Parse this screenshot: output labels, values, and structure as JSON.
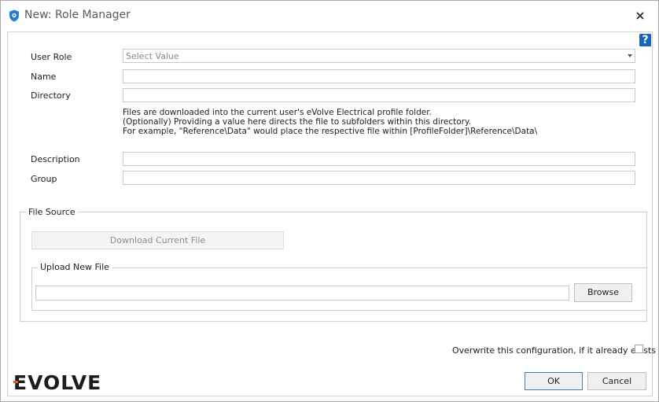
{
  "window": {
    "title": "New: Role Manager",
    "icon": "shield-icon",
    "close_glyph": "✕"
  },
  "help": {
    "label": "?"
  },
  "form": {
    "user_role": {
      "label": "User Role",
      "placeholder": "Select Value"
    },
    "name": {
      "label": "Name",
      "value": ""
    },
    "directory": {
      "label": "Directory",
      "value": "",
      "help_lines": [
        "Files are downloaded into the current user's eVolve Electrical profile folder.",
        "(Optionally) Providing a value here directs the file to subfolders within this directory.",
        "For example, \"Reference\\Data\" would place the respective file within [ProfileFolder]\\Reference\\Data\\"
      ]
    },
    "description": {
      "label": "Description",
      "value": ""
    },
    "group": {
      "label": "Group",
      "value": ""
    }
  },
  "file_source": {
    "title": "File Source",
    "download_button": "Download Current File",
    "upload": {
      "title": "Upload New File",
      "path_value": "",
      "browse_button": "Browse"
    }
  },
  "overwrite": {
    "label": "Overwrite this configuration, if it already exists",
    "checked": false
  },
  "footer": {
    "logo_text": "EVOLVE",
    "ok_button": "OK",
    "cancel_button": "Cancel"
  },
  "colors": {
    "accent": "#1565c0",
    "logo": "#1c1c1c",
    "logo_accent": "#e45a1c"
  }
}
